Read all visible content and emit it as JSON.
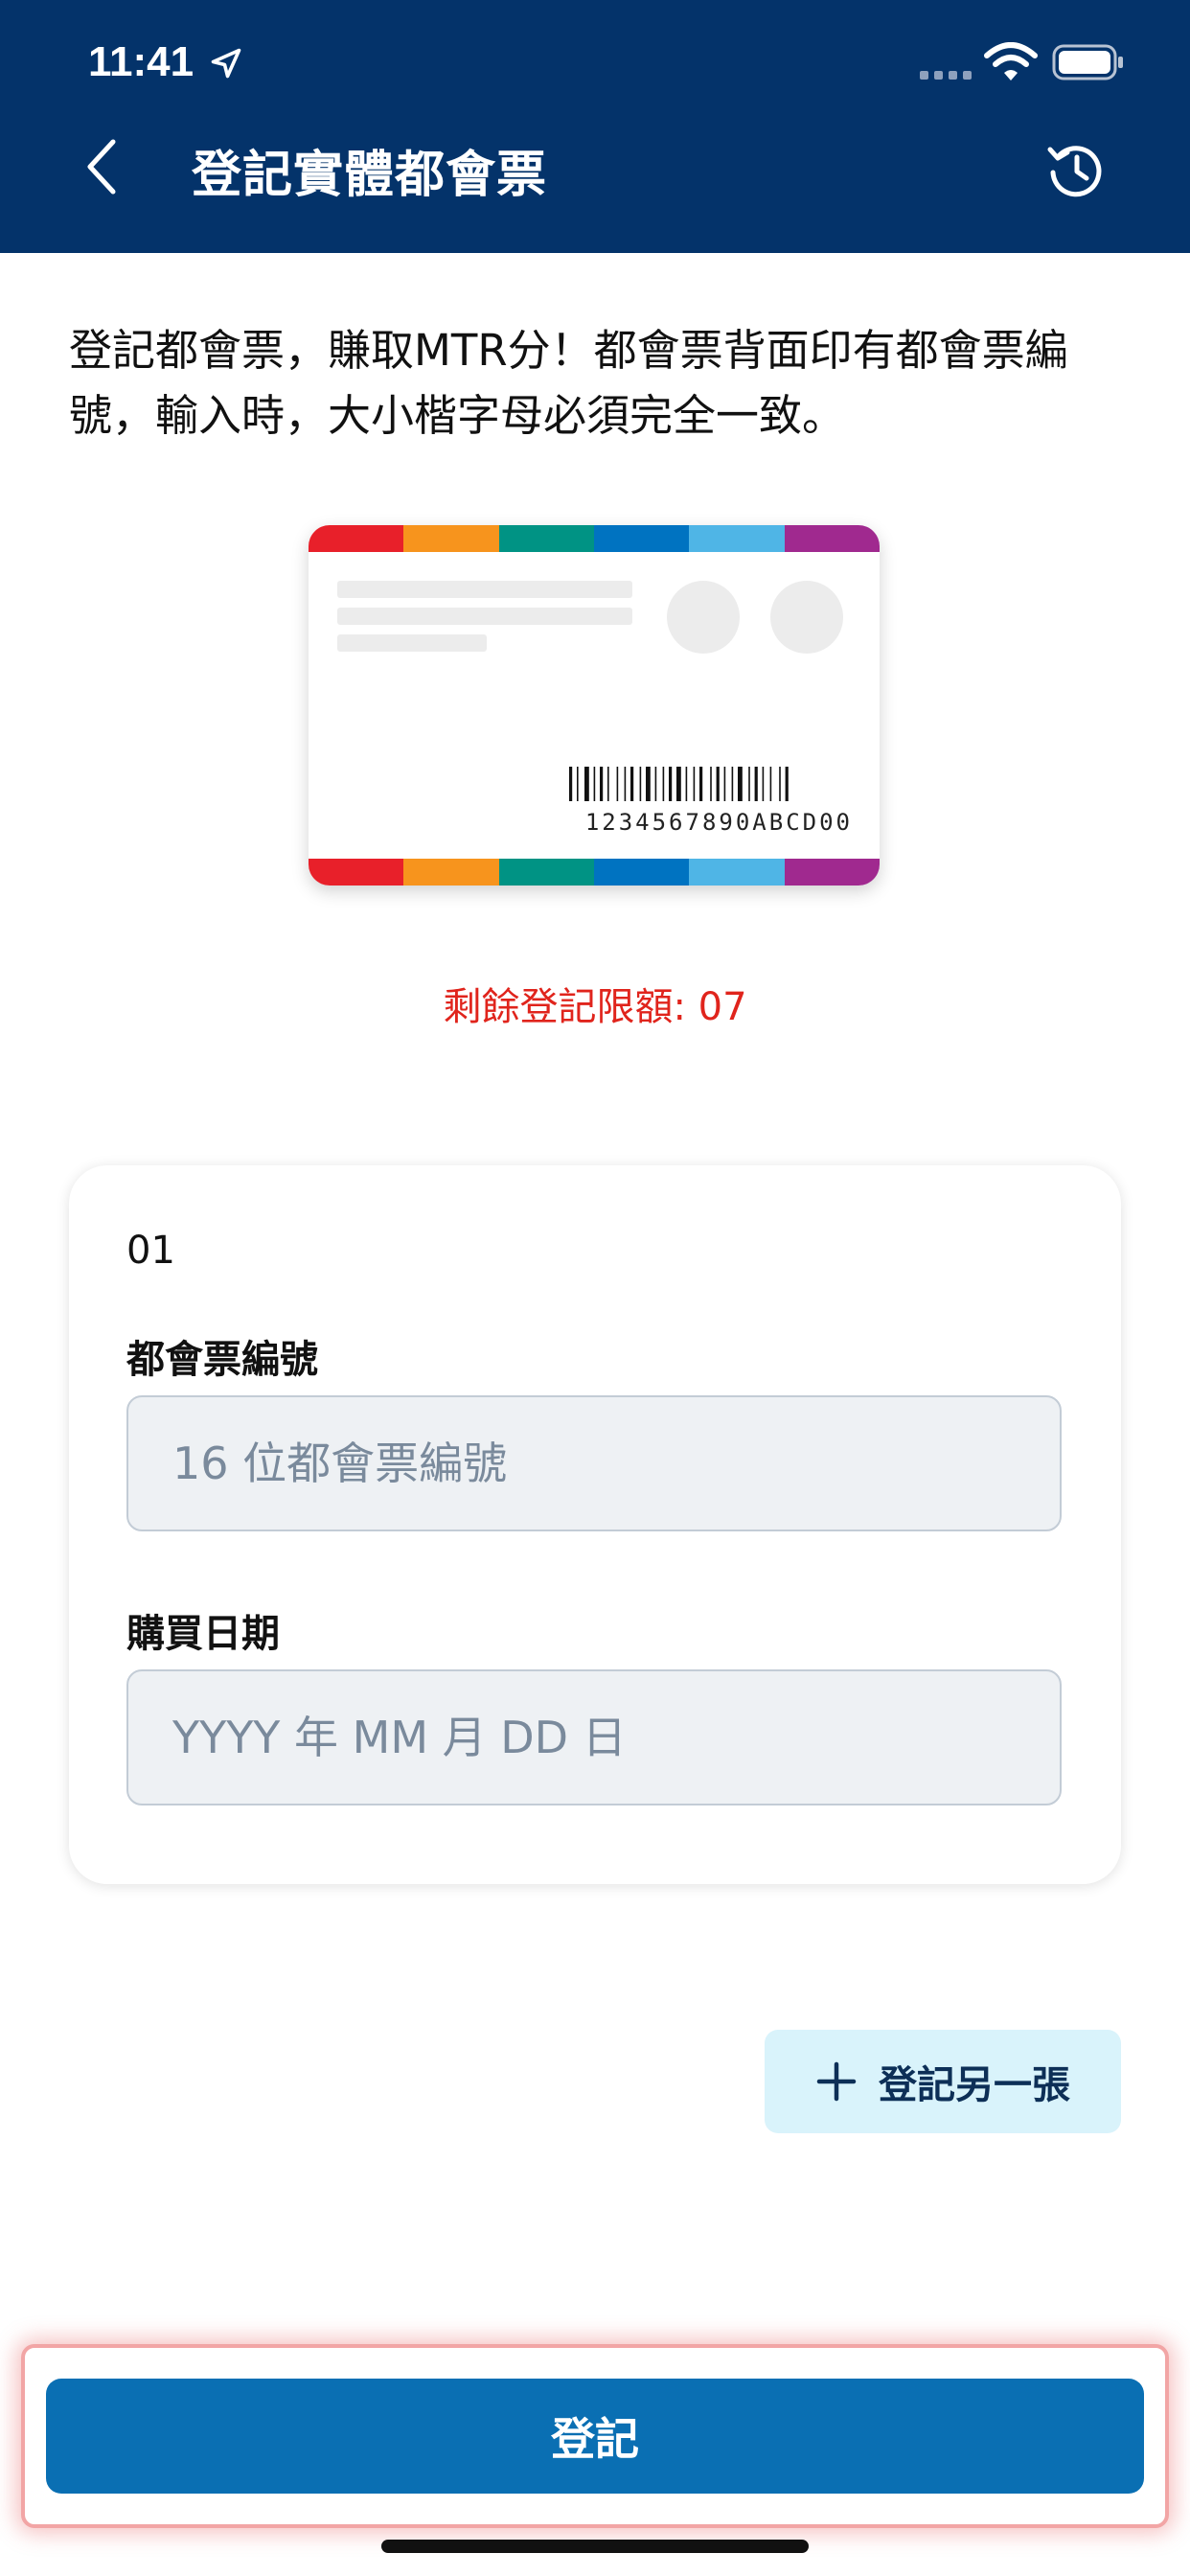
{
  "status_bar": {
    "time": "11:41"
  },
  "header": {
    "title": "登記實體都會票"
  },
  "intro": {
    "text": "登記都會票，賺取MTR分！都會票背面印有都會票編號，輸入時，大小楷字母必須完全一致。"
  },
  "ticket": {
    "number": "1234567890ABCD00",
    "stripe_colors": [
      "#e8202a",
      "#f7941d",
      "#009384",
      "#0073c1",
      "#4fb5e6",
      "#a0298f"
    ]
  },
  "quota": {
    "text": "剩餘登記限額: 07"
  },
  "form": {
    "entry_index": "01",
    "ticket_number_label": "都會票編號",
    "ticket_number_placeholder": "16 位都會票編號",
    "purchase_date_label": "購買日期",
    "purchase_date_placeholder": "YYYY 年 MM 月 DD 日"
  },
  "add_another": {
    "label": "登記另一張"
  },
  "submit": {
    "label": "登記"
  },
  "icons": [
    "location-arrow-icon",
    "wifi-icon",
    "battery-icon",
    "back-chevron-icon",
    "history-icon",
    "plus-icon"
  ],
  "colors": {
    "header": "#04336a",
    "primary": "#0a6fb3",
    "quota": "#e0241c",
    "add_button_bg": "#d9f3fb"
  }
}
